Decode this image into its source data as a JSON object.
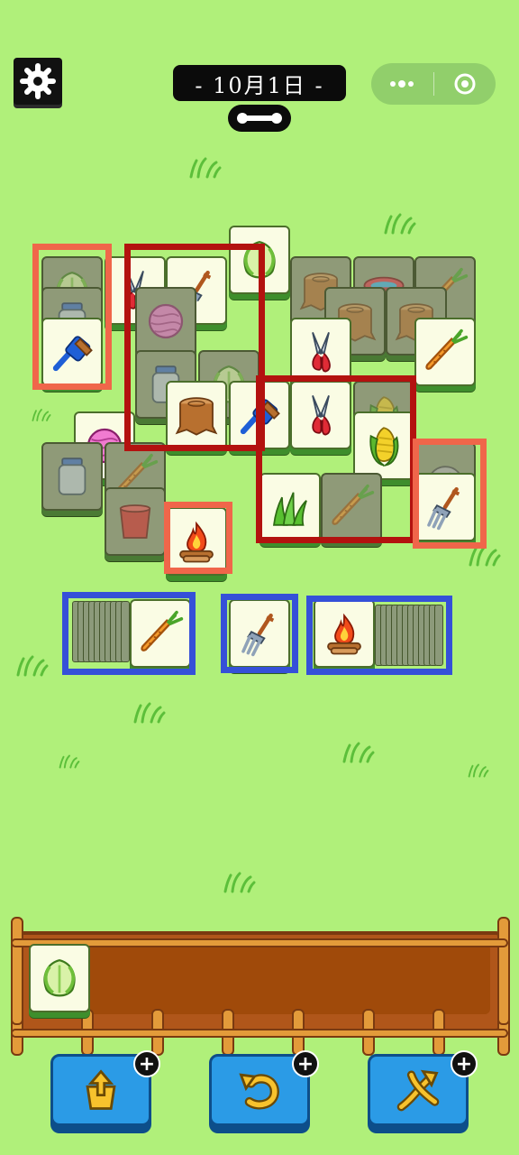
{
  "header": {
    "date_label": "- 10月1日 -",
    "settings_icon": "gear-icon",
    "menu_icon": "more-dots-icon",
    "close_icon": "target-circle-icon"
  },
  "board": {
    "tiles": [
      {
        "id": "lettuce-back",
        "kind": "lettuce",
        "dim": true
      },
      {
        "id": "jar-back",
        "kind": "jar",
        "dim": true
      },
      {
        "id": "brush-left",
        "kind": "brush",
        "dim": false
      },
      {
        "id": "shears-top",
        "kind": "shears",
        "dim": false
      },
      {
        "id": "fork-top",
        "kind": "pitchfork",
        "dim": false
      },
      {
        "id": "lettuce-top",
        "kind": "lettuce",
        "dim": false
      },
      {
        "id": "stump-1",
        "kind": "stump",
        "dim": true
      },
      {
        "id": "basin",
        "kind": "basin",
        "dim": true
      },
      {
        "id": "carrot-back",
        "kind": "carrot",
        "dim": true
      },
      {
        "id": "stump-2",
        "kind": "stump",
        "dim": true
      },
      {
        "id": "stump-3",
        "kind": "stump",
        "dim": true
      },
      {
        "id": "shears-mid",
        "kind": "shears",
        "dim": false
      },
      {
        "id": "carrot-right",
        "kind": "carrot",
        "dim": false
      },
      {
        "id": "yarn-back",
        "kind": "yarn",
        "dim": true
      },
      {
        "id": "jar-mid",
        "kind": "jar",
        "dim": true
      },
      {
        "id": "lettuce-mid",
        "kind": "lettuce",
        "dim": true
      },
      {
        "id": "stump-center",
        "kind": "stump",
        "dim": false
      },
      {
        "id": "brush-center",
        "kind": "brush",
        "dim": false
      },
      {
        "id": "shears-center",
        "kind": "shears",
        "dim": false
      },
      {
        "id": "corn-back",
        "kind": "corn",
        "dim": true
      },
      {
        "id": "yarn-front",
        "kind": "yarn",
        "dim": false
      },
      {
        "id": "jar-low",
        "kind": "jar",
        "dim": true
      },
      {
        "id": "carrot-low",
        "kind": "carrot",
        "dim": true
      },
      {
        "id": "corn-front",
        "kind": "corn",
        "dim": false
      },
      {
        "id": "rock-back",
        "kind": "rock",
        "dim": true
      },
      {
        "id": "fork-right",
        "kind": "pitchfork",
        "dim": false
      },
      {
        "id": "grass-front",
        "kind": "grass",
        "dim": false
      },
      {
        "id": "carrot-mid-low",
        "kind": "carrot",
        "dim": true
      },
      {
        "id": "bucket-low",
        "kind": "bucket",
        "dim": true
      },
      {
        "id": "fire-front",
        "kind": "campfire",
        "dim": false
      }
    ]
  },
  "trays": {
    "left_stack_top": "carrot",
    "center_single": "pitchfork",
    "right_stack_top": "campfire"
  },
  "slot_bar": {
    "collected": [
      "lettuce"
    ]
  },
  "tools": [
    {
      "name": "move-out",
      "icon": "box-arrow-up-icon",
      "badge": "+"
    },
    {
      "name": "undo",
      "icon": "undo-icon",
      "badge": "+"
    },
    {
      "name": "shuffle",
      "icon": "shuffle-icon",
      "badge": "+"
    }
  ],
  "colors": {
    "background": "#b0f07a",
    "highlight_orange": "#f0664a",
    "highlight_red": "#b3120f",
    "highlight_blue": "#3550d8",
    "tool_button": "#2b9be6"
  }
}
